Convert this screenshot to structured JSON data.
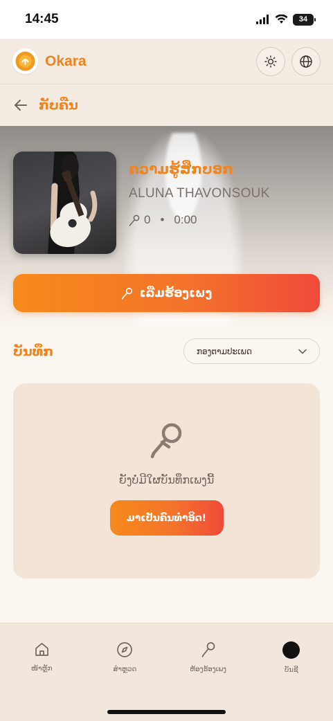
{
  "status_bar": {
    "time": "14:45",
    "battery": "34"
  },
  "header": {
    "brand": "Okara",
    "theme_icon": "sun-icon",
    "language_icon": "globe-icon"
  },
  "page": {
    "back_icon": "arrow-left-icon",
    "title": "ກັບຄືນ"
  },
  "song": {
    "title": "ຄວາມຮູ້ສຶກບອກ",
    "artist": "ALUNA THAVONSOUK",
    "plays": "0",
    "duration": "0:00",
    "start_button": "ເລີ່ມຮ້ອງເພງ"
  },
  "records": {
    "label": "ບັນທຶກ",
    "filter_value": "ກອງຕາມປະເພດ"
  },
  "empty_state": {
    "message": "ຍັງບໍ່ມີໃຜບັນທຶກເພງນີ້",
    "cta": "ມາເປັນຄົນທຳອິດ!"
  },
  "bottom_nav": {
    "items": [
      {
        "label": "ໜ້າຫຼັກ",
        "icon": "home-icon"
      },
      {
        "label": "ສຳຫຼວດ",
        "icon": "compass-icon"
      },
      {
        "label": "ຫ້ອງຮ້ອງເພງ",
        "icon": "microphone-icon"
      },
      {
        "label": "ບັນຊີ",
        "icon": "avatar-icon"
      }
    ]
  },
  "colors": {
    "accent": "#f08420",
    "gradient_end": "#ef4a3a",
    "background": "#fbf6f0"
  }
}
